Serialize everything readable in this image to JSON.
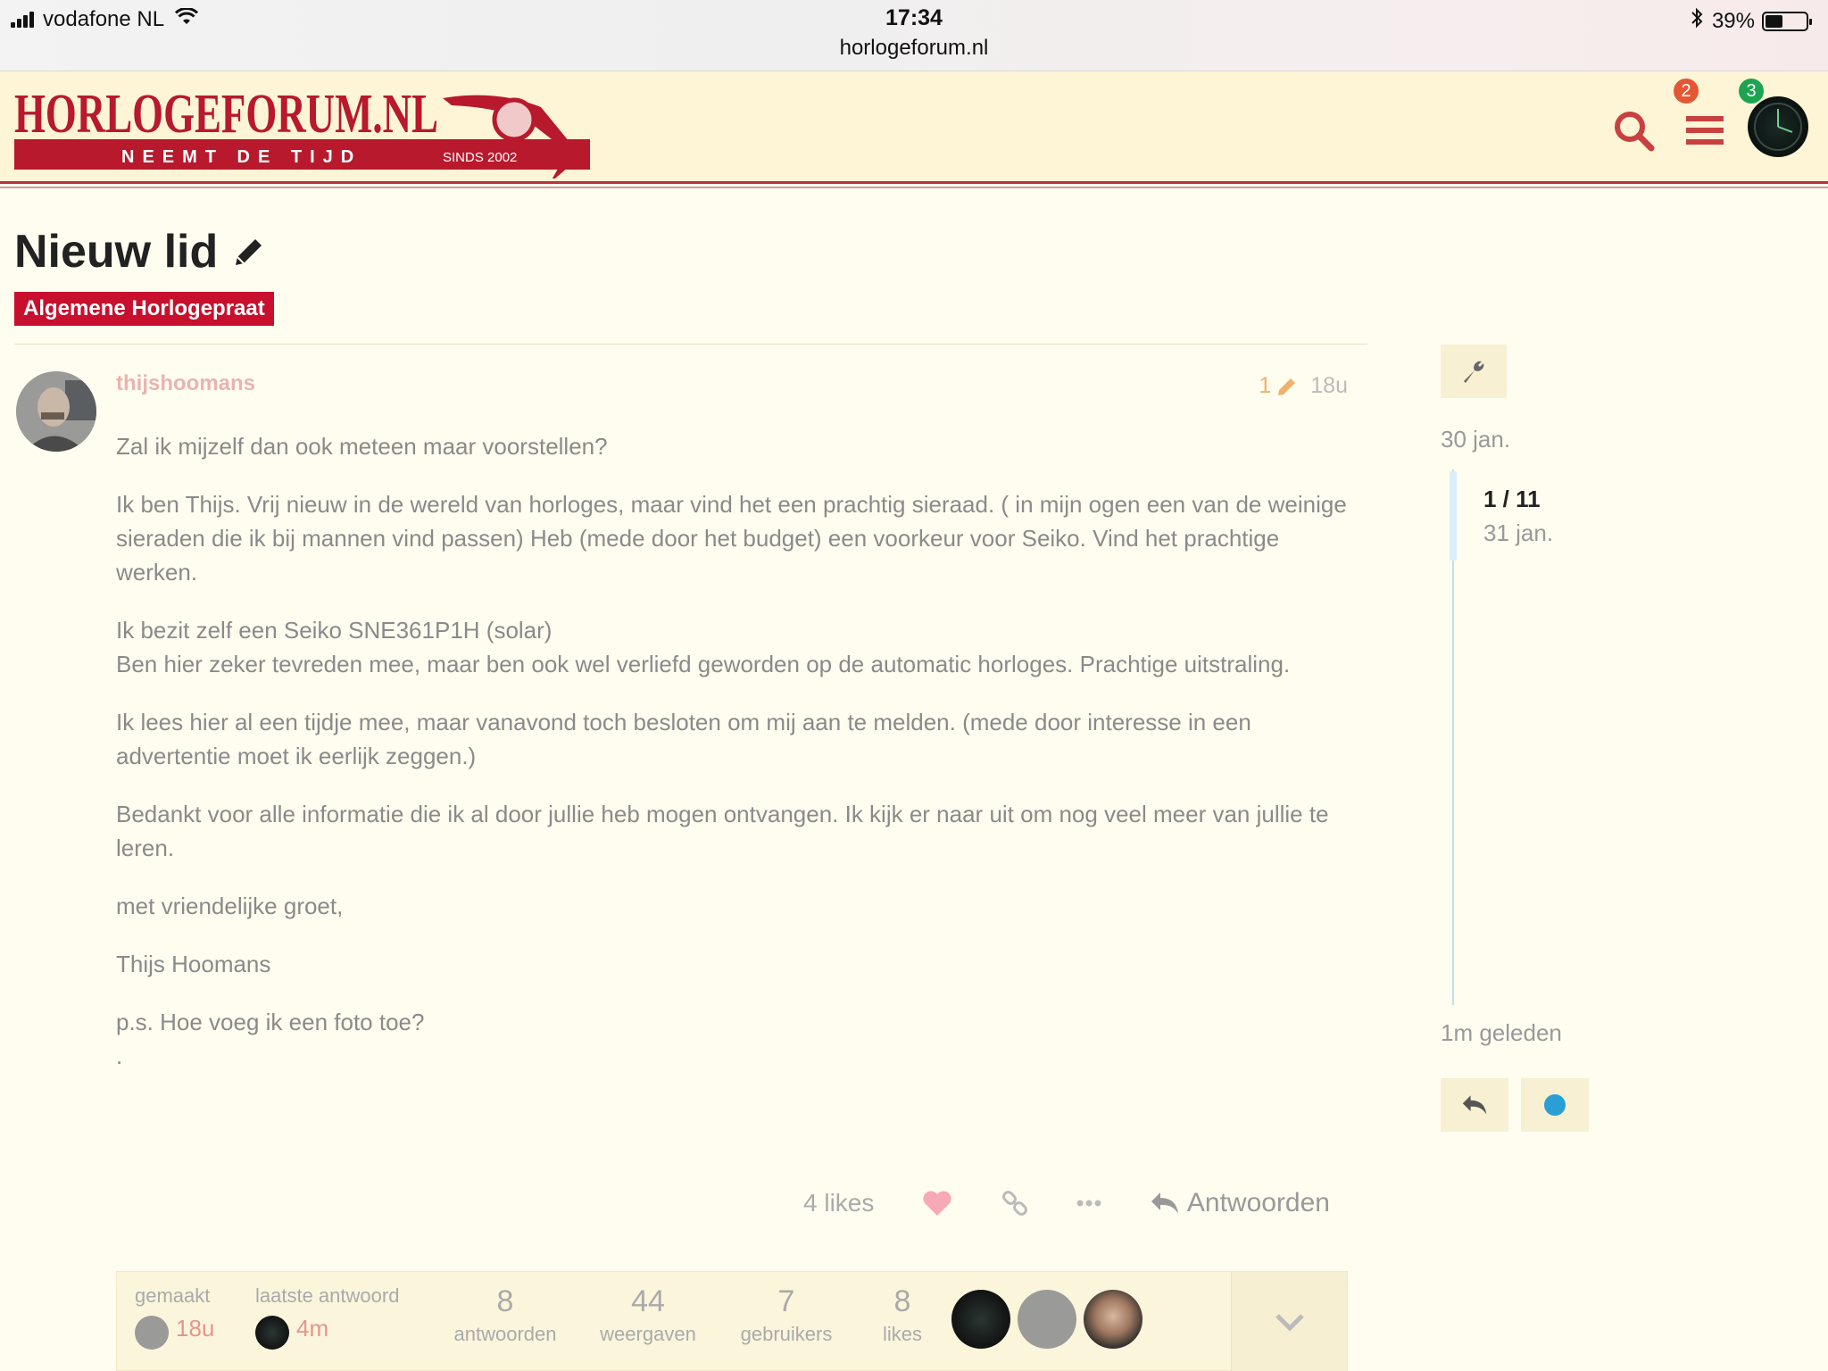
{
  "status_bar": {
    "carrier": "vodafone NL",
    "time": "17:34",
    "url": "horlogeforum.nl",
    "battery": "39%",
    "battery_level": 0.39
  },
  "header": {
    "logo_text": "HORLOGEFORUM.NL",
    "logo_tagline": "NEEMT DE TIJD",
    "logo_since": "SINDS 2002",
    "menu_badge": "2",
    "avatar_badge": "3",
    "brand_color": "#c8102e"
  },
  "topic": {
    "title": "Nieuw lid",
    "category": "Algemene Horlogepraat"
  },
  "post": {
    "username": "thijshoomans",
    "edit_count": "1",
    "age": "18u",
    "paragraphs": [
      "Zal ik mijzelf dan ook meteen maar voorstellen?",
      "Ik ben Thijs. Vrij nieuw in de wereld van horloges, maar vind het een prachtig sieraad. ( in mijn ogen een van de weinige sieraden die ik bij mannen vind passen) Heb (mede door het budget) een voorkeur voor Seiko. Vind het prachtige werken.",
      "Ik bezit zelf een Seiko SNE361P1H (solar)\nBen hier zeker tevreden mee, maar ben ook wel verliefd geworden op de automatic horloges. Prachtige uitstraling.",
      "Ik lees hier al een tijdje mee, maar vanavond toch besloten om mij aan te melden. (mede door interesse in een advertentie moet ik eerlijk zeggen.)",
      "Bedankt voor alle informatie die ik al door jullie heb mogen ontvangen. Ik kijk er naar uit om nog veel meer van jullie te leren.",
      "met vriendelijke groet,",
      "Thijs Hoomans",
      "p.s. Hoe voeg ik een foto toe?\n."
    ],
    "likes_label": "4 likes",
    "reply_label": "Antwoorden"
  },
  "topic_map": {
    "created_label": "gemaakt",
    "created_time": "18u",
    "last_reply_label": "laatste antwoord",
    "last_reply_time": "4m",
    "replies_value": "8",
    "replies_label": "antwoorden",
    "views_value": "44",
    "views_label": "weergaven",
    "users_value": "7",
    "users_label": "gebruikers",
    "likes_value": "8",
    "likes_label": "likes"
  },
  "timeline": {
    "start_date": "30 jan.",
    "position": "1 / 11",
    "position_date": "31 jan.",
    "end_label": "1m geleden"
  }
}
